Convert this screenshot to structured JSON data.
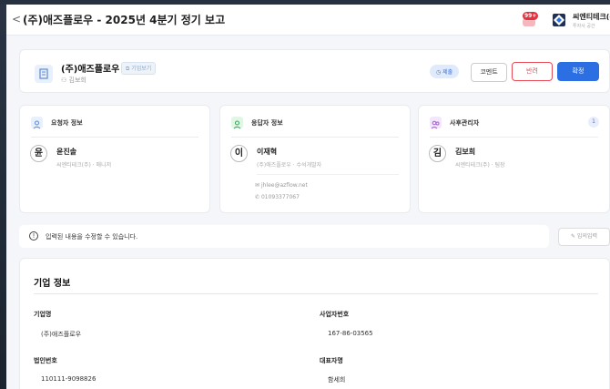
{
  "header": {
    "back": "<",
    "title": "(주)애즈플로우 - 2025년 4분기 정기 보고",
    "notification_badge": "99+",
    "company_name": "씨엔티테크(주)",
    "company_sub": "투자사 공간"
  },
  "report": {
    "company": "(주)애즈플로우",
    "link_label": "⧉ 기업보기",
    "person": "김보희",
    "status": "제출",
    "buttons": {
      "comment": "코멘트",
      "reject": "반려",
      "confirm": "확정"
    }
  },
  "requester": {
    "title": "요청자 정보",
    "initial": "윤",
    "name": "윤진솔",
    "meta": "씨엔티테크(주) · 매니저"
  },
  "respondent": {
    "title": "응답자 정보",
    "initial": "이",
    "name": "이재혁",
    "meta": "(주)애즈플로우 · 수석개발자",
    "email": "jhlee@azflow.net",
    "phone": "01093377067"
  },
  "manager": {
    "title": "사후관리자",
    "count": "1",
    "initial": "김",
    "name": "김보희",
    "meta": "씨엔티테크(주) · 팀장"
  },
  "notice": {
    "text": "입력된 내용을 수정할 수 있습니다.",
    "temp_save": "임의입력"
  },
  "company_info": {
    "title": "기업 정보",
    "fields": [
      {
        "label": "기업명",
        "value": "(주)애즈플로우"
      },
      {
        "label": "사업자번호",
        "value": "167-86-03565"
      },
      {
        "label": "법인번호",
        "value": "110111-9098826"
      },
      {
        "label": "대표자명",
        "value": "함세희"
      }
    ]
  },
  "colors": {
    "accent": "#2b6fe3",
    "reject": "#e74a55",
    "requester_icon": "#e8f0fb",
    "respondent_icon": "#e2f6e6",
    "manager_icon": "#f3e7fb"
  }
}
